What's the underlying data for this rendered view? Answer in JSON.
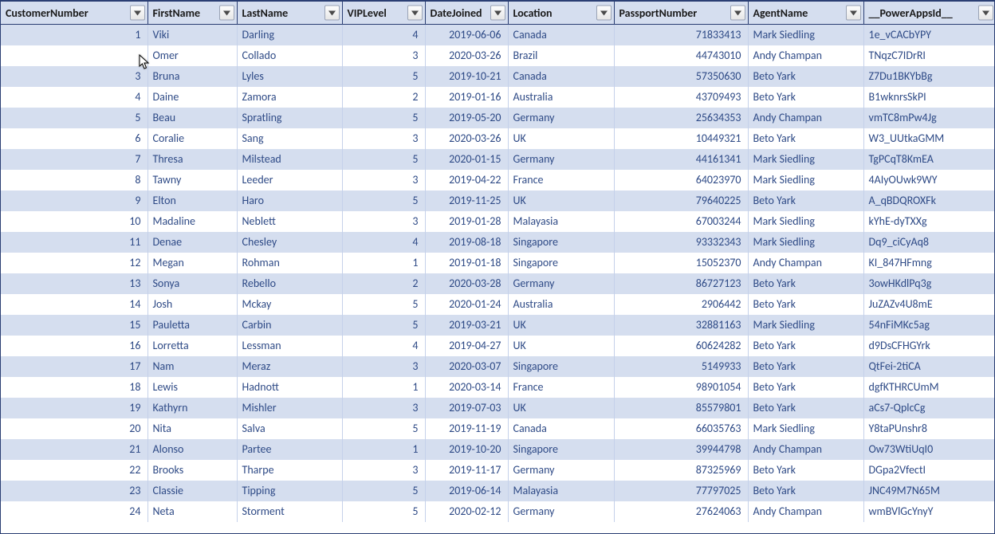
{
  "columns": [
    {
      "key": "CustomerNumber",
      "label": "CustomerNumber",
      "align": "right"
    },
    {
      "key": "FirstName",
      "label": "FirstName",
      "align": "left"
    },
    {
      "key": "LastName",
      "label": "LastName",
      "align": "left"
    },
    {
      "key": "VIPLevel",
      "label": "VIPLevel",
      "align": "right"
    },
    {
      "key": "DateJoined",
      "label": "DateJoined",
      "align": "right"
    },
    {
      "key": "Location",
      "label": "Location",
      "align": "left"
    },
    {
      "key": "PassportNumber",
      "label": "PassportNumber",
      "align": "right"
    },
    {
      "key": "AgentName",
      "label": "AgentName",
      "align": "left"
    },
    {
      "key": "PowerAppsId",
      "label": "__PowerAppsId__",
      "align": "left"
    }
  ],
  "rows": [
    {
      "CustomerNumber": "1",
      "FirstName": "Viki",
      "LastName": "Darling",
      "VIPLevel": "4",
      "DateJoined": "2019-06-06",
      "Location": "Canada",
      "PassportNumber": "71833413",
      "AgentName": "Mark Siedling",
      "PowerAppsId": "1e_vCACbYPY"
    },
    {
      "CustomerNumber": "",
      "FirstName": "Omer",
      "LastName": "Collado",
      "VIPLevel": "3",
      "DateJoined": "2020-03-26",
      "Location": "Brazil",
      "PassportNumber": "44743010",
      "AgentName": "Andy Champan",
      "PowerAppsId": "TNqzC7IDrRI"
    },
    {
      "CustomerNumber": "3",
      "FirstName": "Bruna",
      "LastName": "Lyles",
      "VIPLevel": "5",
      "DateJoined": "2019-10-21",
      "Location": "Canada",
      "PassportNumber": "57350630",
      "AgentName": "Beto Yark",
      "PowerAppsId": "Z7Du1BKYbBg"
    },
    {
      "CustomerNumber": "4",
      "FirstName": "Daine",
      "LastName": "Zamora",
      "VIPLevel": "2",
      "DateJoined": "2019-01-16",
      "Location": "Australia",
      "PassportNumber": "43709493",
      "AgentName": "Beto Yark",
      "PowerAppsId": "B1wknrsSkPI"
    },
    {
      "CustomerNumber": "5",
      "FirstName": "Beau",
      "LastName": "Spratling",
      "VIPLevel": "5",
      "DateJoined": "2019-05-20",
      "Location": "Germany",
      "PassportNumber": "25634353",
      "AgentName": "Andy Champan",
      "PowerAppsId": "vmTC8mPw4Jg"
    },
    {
      "CustomerNumber": "6",
      "FirstName": "Coralie",
      "LastName": "Sang",
      "VIPLevel": "3",
      "DateJoined": "2020-03-26",
      "Location": "UK",
      "PassportNumber": "10449321",
      "AgentName": "Beto Yark",
      "PowerAppsId": "W3_UUtkaGMM"
    },
    {
      "CustomerNumber": "7",
      "FirstName": "Thresa",
      "LastName": "Milstead",
      "VIPLevel": "5",
      "DateJoined": "2020-01-15",
      "Location": "Germany",
      "PassportNumber": "44161341",
      "AgentName": "Mark Siedling",
      "PowerAppsId": "TgPCqT8KmEA"
    },
    {
      "CustomerNumber": "8",
      "FirstName": "Tawny",
      "LastName": "Leeder",
      "VIPLevel": "3",
      "DateJoined": "2019-04-22",
      "Location": "France",
      "PassportNumber": "64023970",
      "AgentName": "Mark Siedling",
      "PowerAppsId": "4AIyOUwk9WY"
    },
    {
      "CustomerNumber": "9",
      "FirstName": "Elton",
      "LastName": "Haro",
      "VIPLevel": "5",
      "DateJoined": "2019-11-25",
      "Location": "UK",
      "PassportNumber": "79640225",
      "AgentName": "Beto Yark",
      "PowerAppsId": "A_qBDQROXFk"
    },
    {
      "CustomerNumber": "10",
      "FirstName": "Madaline",
      "LastName": "Neblett",
      "VIPLevel": "3",
      "DateJoined": "2019-01-28",
      "Location": "Malayasia",
      "PassportNumber": "67003244",
      "AgentName": "Mark Siedling",
      "PowerAppsId": "kYhE-dyTXXg"
    },
    {
      "CustomerNumber": "11",
      "FirstName": "Denae",
      "LastName": "Chesley",
      "VIPLevel": "4",
      "DateJoined": "2019-08-18",
      "Location": "Singapore",
      "PassportNumber": "93332343",
      "AgentName": "Mark Siedling",
      "PowerAppsId": "Dq9_ciCyAq8"
    },
    {
      "CustomerNumber": "12",
      "FirstName": "Megan",
      "LastName": "Rohman",
      "VIPLevel": "1",
      "DateJoined": "2019-01-18",
      "Location": "Singapore",
      "PassportNumber": "15052370",
      "AgentName": "Andy Champan",
      "PowerAppsId": "KI_847HFmng"
    },
    {
      "CustomerNumber": "13",
      "FirstName": "Sonya",
      "LastName": "Rebello",
      "VIPLevel": "2",
      "DateJoined": "2020-03-28",
      "Location": "Germany",
      "PassportNumber": "86727123",
      "AgentName": "Beto Yark",
      "PowerAppsId": "3owHKdlPq3g"
    },
    {
      "CustomerNumber": "14",
      "FirstName": "Josh",
      "LastName": "Mckay",
      "VIPLevel": "5",
      "DateJoined": "2020-01-24",
      "Location": "Australia",
      "PassportNumber": "2906442",
      "AgentName": "Beto Yark",
      "PowerAppsId": "JuZAZv4U8mE"
    },
    {
      "CustomerNumber": "15",
      "FirstName": "Pauletta",
      "LastName": "Carbin",
      "VIPLevel": "5",
      "DateJoined": "2019-03-21",
      "Location": "UK",
      "PassportNumber": "32881163",
      "AgentName": "Mark Siedling",
      "PowerAppsId": "54nFiMKc5ag"
    },
    {
      "CustomerNumber": "16",
      "FirstName": "Lorretta",
      "LastName": "Lessman",
      "VIPLevel": "4",
      "DateJoined": "2019-04-27",
      "Location": "UK",
      "PassportNumber": "60624282",
      "AgentName": "Beto Yark",
      "PowerAppsId": "d9DsCFHGYrk"
    },
    {
      "CustomerNumber": "17",
      "FirstName": "Nam",
      "LastName": "Meraz",
      "VIPLevel": "3",
      "DateJoined": "2020-03-07",
      "Location": "Singapore",
      "PassportNumber": "5149933",
      "AgentName": "Beto Yark",
      "PowerAppsId": "QtFei-2tiCA"
    },
    {
      "CustomerNumber": "18",
      "FirstName": "Lewis",
      "LastName": "Hadnott",
      "VIPLevel": "1",
      "DateJoined": "2020-03-14",
      "Location": "France",
      "PassportNumber": "98901054",
      "AgentName": "Beto Yark",
      "PowerAppsId": "dgfKTHRCUmM"
    },
    {
      "CustomerNumber": "19",
      "FirstName": "Kathyrn",
      "LastName": "Mishler",
      "VIPLevel": "3",
      "DateJoined": "2019-07-03",
      "Location": "UK",
      "PassportNumber": "85579801",
      "AgentName": "Beto Yark",
      "PowerAppsId": "aCs7-QplcCg"
    },
    {
      "CustomerNumber": "20",
      "FirstName": "Nita",
      "LastName": "Salva",
      "VIPLevel": "5",
      "DateJoined": "2019-11-19",
      "Location": "Canada",
      "PassportNumber": "66035763",
      "AgentName": "Mark Siedling",
      "PowerAppsId": "Y8taPUnshr8"
    },
    {
      "CustomerNumber": "21",
      "FirstName": "Alonso",
      "LastName": "Partee",
      "VIPLevel": "1",
      "DateJoined": "2019-10-20",
      "Location": "Singapore",
      "PassportNumber": "39944798",
      "AgentName": "Andy Champan",
      "PowerAppsId": "Ow73WtiUqI0"
    },
    {
      "CustomerNumber": "22",
      "FirstName": "Brooks",
      "LastName": "Tharpe",
      "VIPLevel": "3",
      "DateJoined": "2019-11-17",
      "Location": "Germany",
      "PassportNumber": "87325969",
      "AgentName": "Beto Yark",
      "PowerAppsId": "DGpa2VfectI"
    },
    {
      "CustomerNumber": "23",
      "FirstName": "Classie",
      "LastName": "Tipping",
      "VIPLevel": "5",
      "DateJoined": "2019-06-14",
      "Location": "Malayasia",
      "PassportNumber": "77797025",
      "AgentName": "Beto Yark",
      "PowerAppsId": "JNC49M7N65M"
    },
    {
      "CustomerNumber": "24",
      "FirstName": "Neta",
      "LastName": "Storment",
      "VIPLevel": "5",
      "DateJoined": "2020-02-12",
      "Location": "Germany",
      "PassportNumber": "27624063",
      "AgentName": "Andy Champan",
      "PowerAppsId": "wmBVlGcYnyY"
    }
  ]
}
